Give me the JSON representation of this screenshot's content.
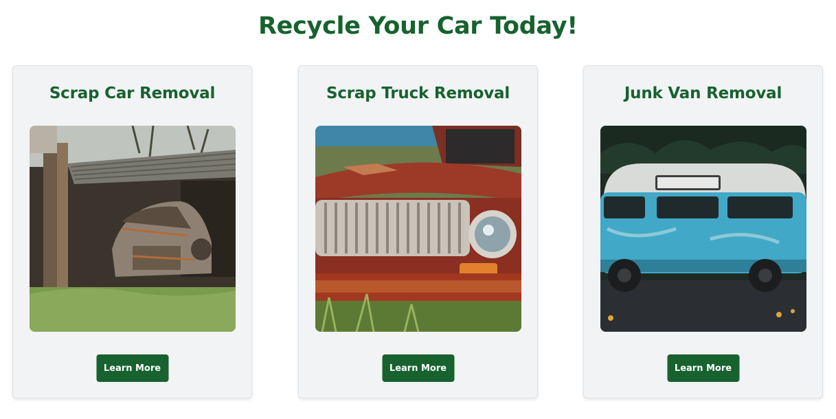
{
  "page": {
    "title": "Recycle Your Car Today!"
  },
  "colors": {
    "brand_green": "#17622f",
    "card_bg": "#f2f3f5",
    "button_text": "#ffffff"
  },
  "cards": [
    {
      "title": "Scrap Car Removal",
      "button_label": "Learn More",
      "image_alt": "Rusted abandoned car under a broken shed"
    },
    {
      "title": "Scrap Truck Removal",
      "button_label": "Learn More",
      "image_alt": "Rusty red truck grille and headlight"
    },
    {
      "title": "Junk Van Removal",
      "button_label": "Learn More",
      "image_alt": "Weathered blue camper van"
    }
  ]
}
